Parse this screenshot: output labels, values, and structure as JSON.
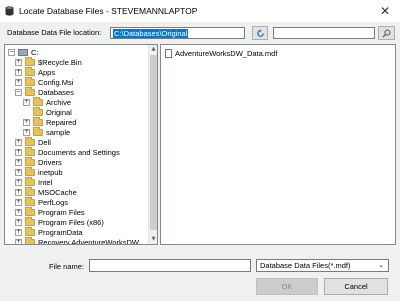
{
  "window": {
    "title": "Locate Database Files - STEVEMANNLAPTOP",
    "close_icon": "close-icon"
  },
  "location": {
    "label": "Database Data File location:",
    "value": "C:\\Databases\\Original",
    "refresh_icon": "refresh-icon",
    "search_placeholder": "",
    "search_icon": "search-icon"
  },
  "tree": {
    "items": [
      {
        "label": "C:",
        "expander": "−",
        "type": "drive"
      },
      {
        "label": "$Recycle.Bin",
        "expander": "+",
        "type": "folder"
      },
      {
        "label": "Apps",
        "expander": "+",
        "type": "folder"
      },
      {
        "label": "Config.Msi",
        "expander": "+",
        "type": "folder"
      },
      {
        "label": "Databases",
        "expander": "−",
        "type": "folder"
      },
      {
        "label": "Archive",
        "expander": "+",
        "type": "folder"
      },
      {
        "label": "Original",
        "expander": "",
        "type": "folder"
      },
      {
        "label": "Repaired",
        "expander": "+",
        "type": "folder"
      },
      {
        "label": "sample",
        "expander": "+",
        "type": "folder"
      },
      {
        "label": "Dell",
        "expander": "+",
        "type": "folder"
      },
      {
        "label": "Documents and Settings",
        "expander": "+",
        "type": "folder"
      },
      {
        "label": "Drivers",
        "expander": "+",
        "type": "folder"
      },
      {
        "label": "inetpub",
        "expander": "+",
        "type": "folder"
      },
      {
        "label": "Intel",
        "expander": "+",
        "type": "folder"
      },
      {
        "label": "MSOCache",
        "expander": "+",
        "type": "folder"
      },
      {
        "label": "PerfLogs",
        "expander": "+",
        "type": "folder"
      },
      {
        "label": "Program Files",
        "expander": "+",
        "type": "folder"
      },
      {
        "label": "Program Files (x86)",
        "expander": "+",
        "type": "folder"
      },
      {
        "label": "ProgramData",
        "expander": "+",
        "type": "folder"
      },
      {
        "label": "Recovery.AdventureWorksDW...",
        "expander": "+",
        "type": "folder"
      }
    ]
  },
  "files": [
    {
      "name": "AdventureWorksDW_Data.mdf",
      "icon": "file-icon"
    }
  ],
  "footer": {
    "filename_label": "File name:",
    "filename_value": "",
    "filetype_value": "Database Data Files(*.mdf)",
    "ok_label": "OK",
    "cancel_label": "Cancel"
  }
}
